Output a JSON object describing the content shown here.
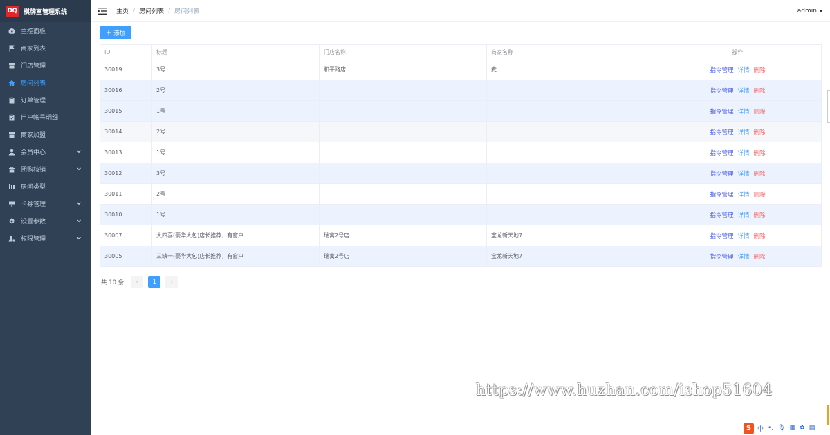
{
  "brand": {
    "logo_text": "DQ",
    "title": "棋牌室管理系统"
  },
  "sidebar": {
    "items": [
      {
        "label": "主控面板",
        "icon": "dashboard-icon",
        "active": false,
        "expandable": false
      },
      {
        "label": "商家列表",
        "icon": "flag-icon",
        "active": false,
        "expandable": false
      },
      {
        "label": "门店管理",
        "icon": "store-icon",
        "active": false,
        "expandable": false
      },
      {
        "label": "房间列表",
        "icon": "home-icon",
        "active": true,
        "expandable": false
      },
      {
        "label": "订单管理",
        "icon": "clipboard-icon",
        "active": false,
        "expandable": false
      },
      {
        "label": "用户帐号明细",
        "icon": "check-clipboard-icon",
        "active": false,
        "expandable": false
      },
      {
        "label": "商家加盟",
        "icon": "store-icon",
        "active": false,
        "expandable": false
      },
      {
        "label": "会员中心",
        "icon": "user-icon",
        "active": false,
        "expandable": true
      },
      {
        "label": "团购核销",
        "icon": "gift-icon",
        "active": false,
        "expandable": true
      },
      {
        "label": "房间类型",
        "icon": "bar-chart-icon",
        "active": false,
        "expandable": false
      },
      {
        "label": "卡券管理",
        "icon": "coupon-icon",
        "active": false,
        "expandable": true
      },
      {
        "label": "设置参数",
        "icon": "gear-icon",
        "active": false,
        "expandable": true
      },
      {
        "label": "权限管理",
        "icon": "user-lock-icon",
        "active": false,
        "expandable": true
      }
    ]
  },
  "header": {
    "breadcrumb": [
      "主页",
      "房间列表",
      "房间列表"
    ],
    "user": "admin"
  },
  "toolbar": {
    "add_label": "添加"
  },
  "table": {
    "columns": [
      "ID",
      "标题",
      "门店名称",
      "商家名称",
      "操作"
    ],
    "actions": {
      "cmd": "指令管理",
      "detail": "详情",
      "delete": "删除"
    },
    "rows": [
      {
        "id": "30019",
        "title": "3号",
        "store": "和平路店",
        "merchant": "麦"
      },
      {
        "id": "30016",
        "title": "2号",
        "store": "",
        "merchant": ""
      },
      {
        "id": "30015",
        "title": "1号",
        "store": "",
        "merchant": ""
      },
      {
        "id": "30014",
        "title": "2号",
        "store": "",
        "merchant": ""
      },
      {
        "id": "30013",
        "title": "1号",
        "store": "",
        "merchant": ""
      },
      {
        "id": "30012",
        "title": "3号",
        "store": "",
        "merchant": ""
      },
      {
        "id": "30011",
        "title": "2号",
        "store": "",
        "merchant": ""
      },
      {
        "id": "30010",
        "title": "1号",
        "store": "",
        "merchant": ""
      },
      {
        "id": "30007",
        "title": "大四喜(豪华大包)店长推荐，有窗户",
        "store": "瑞寓2号店",
        "merchant": "宝龙新天地7"
      },
      {
        "id": "30005",
        "title": "三缺一(豪华大包)店长推荐，有窗户",
        "store": "瑞寓2号店",
        "merchant": "宝龙新天地7"
      }
    ]
  },
  "pagination": {
    "total_text": "共 10 条",
    "current_page": "1",
    "prev": "‹",
    "next": "›"
  },
  "watermark": "https://www.huzhan.com/ishop51604",
  "ime": {
    "logo": "S",
    "lang": "中"
  }
}
